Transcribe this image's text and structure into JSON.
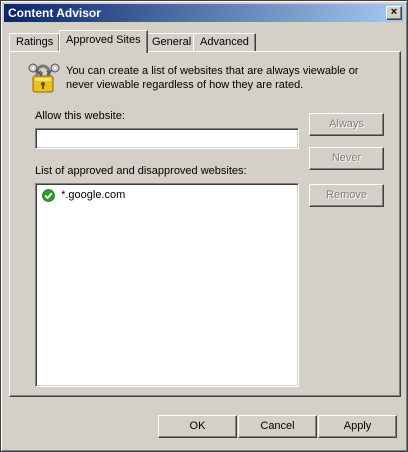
{
  "window": {
    "title": "Content Advisor",
    "close_glyph": "×"
  },
  "tabs": [
    {
      "label": "Ratings",
      "active": false
    },
    {
      "label": "Approved Sites",
      "active": true
    },
    {
      "label": "General",
      "active": false
    },
    {
      "label": "Advanced",
      "active": false
    }
  ],
  "panel": {
    "icon": "keys-lock-icon",
    "description": "You can create a list of websites that are always viewable or never viewable regardless of how they are rated.",
    "allow_label": "Allow this website:",
    "allow_value": "",
    "list_label": "List of approved and disapproved websites:",
    "sites": [
      {
        "status": "approved",
        "url": "*.google.com"
      }
    ],
    "buttons": {
      "always": "Always",
      "never": "Never",
      "remove": "Remove"
    }
  },
  "footer": {
    "ok": "OK",
    "cancel": "Cancel",
    "apply": "Apply"
  },
  "colors": {
    "titlebar_start": "#0a246a",
    "titlebar_end": "#a6caf0",
    "face": "#d4d0c8",
    "approved": "#2e9b2e"
  }
}
